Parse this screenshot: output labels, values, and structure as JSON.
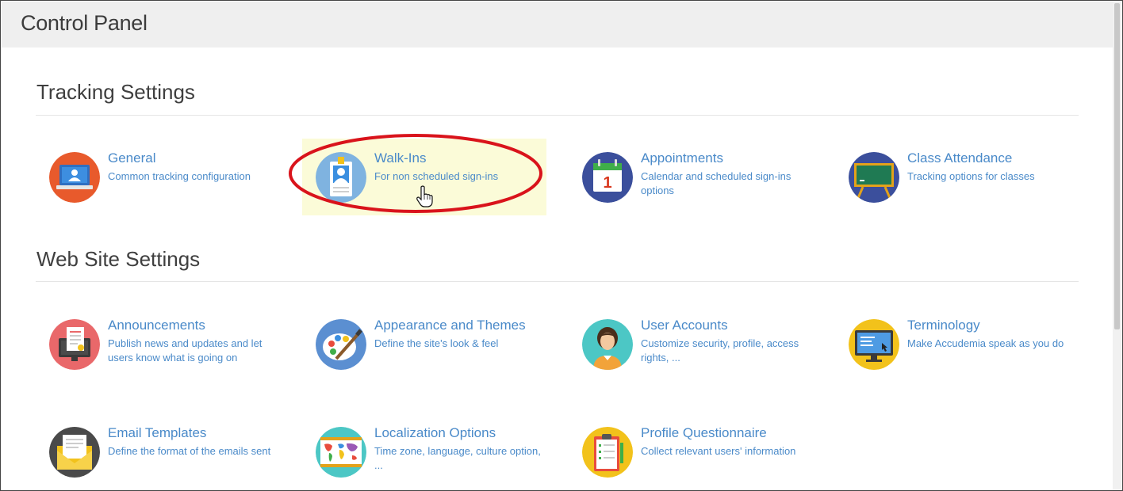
{
  "header": {
    "title": "Control Panel"
  },
  "sections": [
    {
      "title": "Tracking Settings",
      "items": [
        {
          "title": "General",
          "description": "Common tracking configuration",
          "icon": "monitor-user-icon"
        },
        {
          "title": "Walk-Ins",
          "description": "For non scheduled sign-ins",
          "icon": "badge-person-icon"
        },
        {
          "title": "Appointments",
          "description": "Calendar and scheduled sign-ins options",
          "icon": "calendar-icon",
          "calendar_day": "1"
        },
        {
          "title": "Class Attendance",
          "description": "Tracking options for classes",
          "icon": "chalkboard-icon"
        }
      ]
    },
    {
      "title": "Web Site Settings",
      "items": [
        {
          "title": "Announcements",
          "description": "Publish news and updates and let users know what is going on",
          "icon": "announcement-monitor-icon"
        },
        {
          "title": "Appearance and Themes",
          "description": "Define the site's look & feel",
          "icon": "palette-brush-icon"
        },
        {
          "title": "User Accounts",
          "description": "Customize security, profile, access rights, ...",
          "icon": "user-avatar-icon"
        },
        {
          "title": "Terminology",
          "description": "Make Accudemia speak as you do",
          "icon": "terminal-screen-icon"
        },
        {
          "title": "Email Templates",
          "description": "Define the format of the emails sent",
          "icon": "envelope-icon"
        },
        {
          "title": "Localization Options",
          "description": "Time zone, language, culture option, ...",
          "icon": "world-map-icon"
        },
        {
          "title": "Profile Questionnaire",
          "description": "Collect relevant users' information",
          "icon": "clipboard-checklist-icon"
        }
      ]
    }
  ],
  "colors": {
    "link": "#4a8ac9",
    "header_bg": "#efefef",
    "highlight_bg": "#fbfbd8",
    "annotation_red": "#d9131b"
  }
}
